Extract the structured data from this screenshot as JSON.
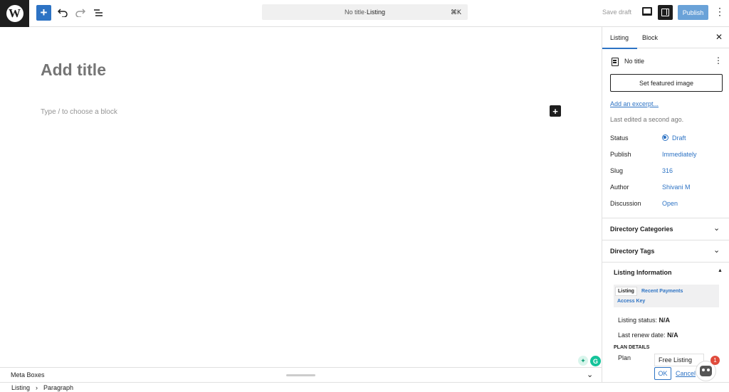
{
  "topbar": {
    "logo": "W",
    "add_label": "+",
    "command": {
      "title": "No title",
      "separator": " · ",
      "post_type": "Listing",
      "shortcut": "⌘K"
    },
    "save_draft": "Save draft",
    "publish": "Publish"
  },
  "editor": {
    "title_placeholder": "Add title",
    "block_placeholder": "Type / to choose a block",
    "add_block": "+",
    "grammarly": "G",
    "bulb": "✦"
  },
  "metabox": {
    "label": "Meta Boxes"
  },
  "breadcrumb": {
    "first": "Listing",
    "separator": "›",
    "second": "Paragraph"
  },
  "sidebar": {
    "tabs": {
      "listing": "Listing",
      "block": "Block"
    },
    "close": "✕",
    "post_title": "No title",
    "featured_image": "Set featured image",
    "excerpt": "Add an excerpt...",
    "last_edited": "Last edited a second ago.",
    "props": {
      "status_label": "Status",
      "status_value": "Draft",
      "publish_label": "Publish",
      "publish_value": "Immediately",
      "slug_label": "Slug",
      "slug_value": "316",
      "author_label": "Author",
      "author_value": "Shivani M",
      "discussion_label": "Discussion",
      "discussion_value": "Open"
    },
    "panels": {
      "categories": "Directory Categories",
      "tags": "Directory Tags"
    },
    "listing_info": {
      "title": "Listing Information",
      "tabs": {
        "listing": "Listing",
        "recent": "Recent Payments",
        "access": "Access Key"
      },
      "status_label": "Listing status:",
      "status_value": "N/A",
      "renew_label": "Last renew date:",
      "renew_value": "N/A",
      "plan_details": "PLAN DETAILS",
      "plan_label": "Plan",
      "plan_value": "Free Listing",
      "ok": "OK",
      "cancel": "Cancel"
    },
    "bot_badge": "1"
  },
  "colors": {
    "accent": "#2d73c4",
    "publish_bg": "#6aa2d8",
    "dark": "#1e1e1e"
  },
  "icons": [
    "wordpress-icon",
    "undo-icon",
    "redo-icon",
    "list-view-icon",
    "preview-icon",
    "settings-icon",
    "kebab-icon",
    "close-icon",
    "document-icon",
    "chevron-down-icon",
    "draft-icon",
    "bot-icon"
  ]
}
